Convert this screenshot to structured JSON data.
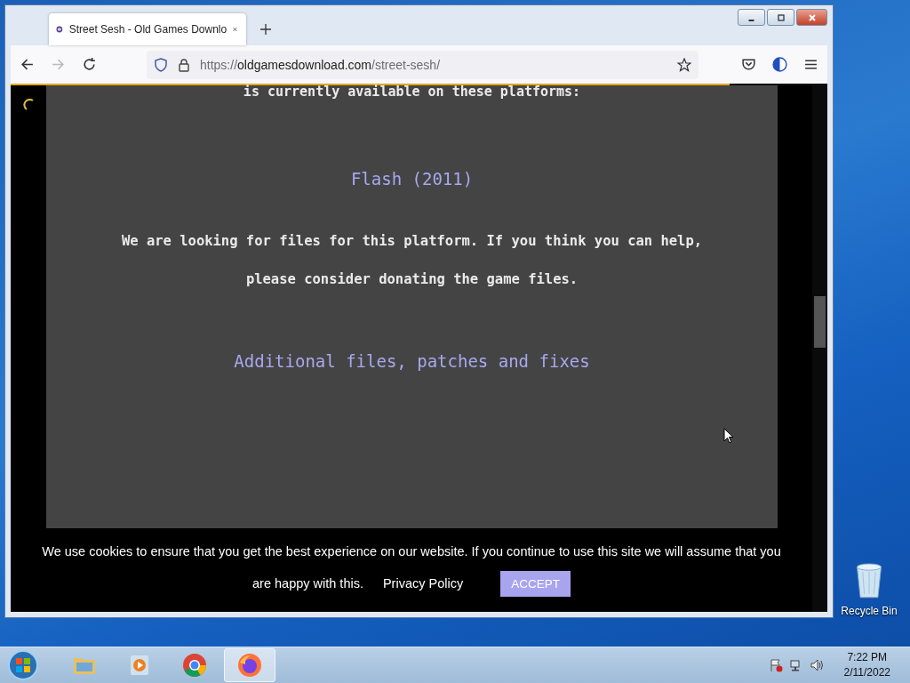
{
  "browser": {
    "tab": {
      "title": "Street Sesh - Old Games Downlo",
      "selected": true
    },
    "url": {
      "scheme": "https://",
      "domain": "oldgamesdownload.com",
      "path": "/street-sesh/"
    },
    "loading": {
      "level": 0.88
    }
  },
  "page": {
    "intro": "is currently available on these platforms:",
    "platform": "Flash (2011)",
    "notice": [
      "We are looking for files for this platform. If you think you can help,",
      "please consider donating the game files."
    ],
    "heading": "Additional files, patches and fixes"
  },
  "cookie_banner": {
    "message": [
      "We use cookies to ensure that you get the best experience on our website. If you continue to use this site we will assume that you",
      "are happy with this."
    ],
    "link": "Privacy Policy",
    "button": "ACCEPT"
  },
  "desktop": {
    "icons": [
      {
        "label": "Recycle Bin"
      }
    ]
  },
  "taskbar": {
    "apps": [
      {
        "kind": "folder",
        "selected": false
      },
      {
        "kind": "media",
        "selected": false
      },
      {
        "kind": "chrome",
        "selected": false
      },
      {
        "kind": "firefox",
        "selected": true
      }
    ],
    "time": "7:22 PM",
    "date": "2/11/2022"
  }
}
